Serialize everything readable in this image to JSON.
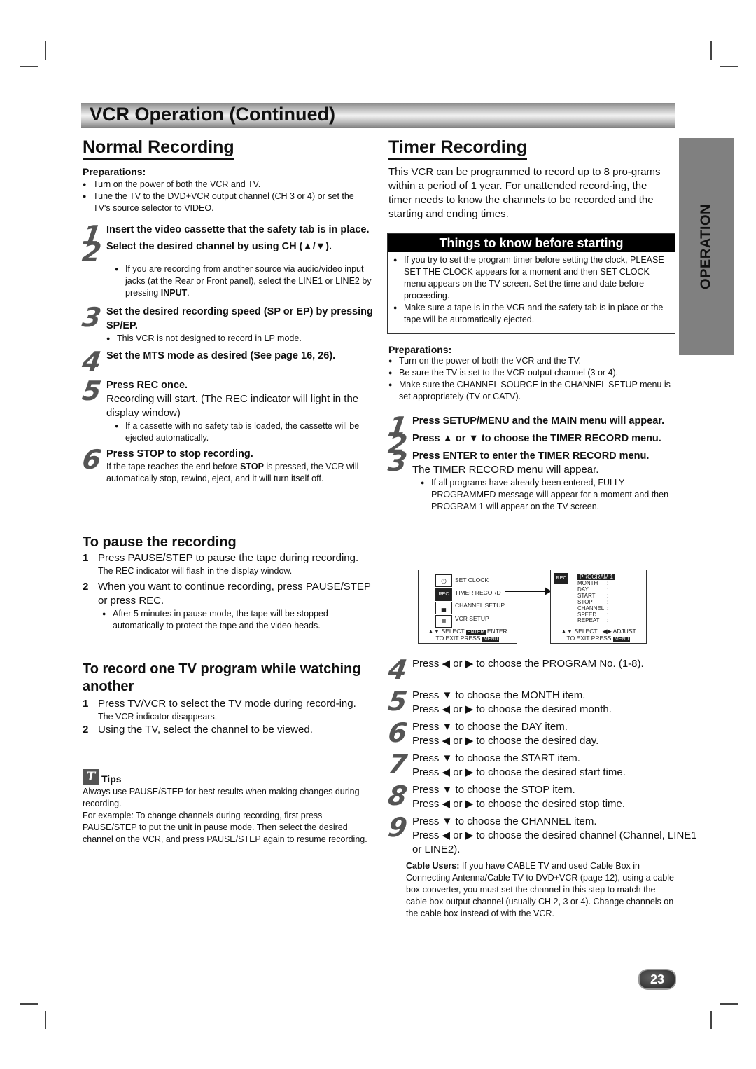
{
  "header": {
    "title": "VCR Operation (Continued)"
  },
  "side_tab": {
    "label": "OPERATION"
  },
  "page_number": "23",
  "normal_recording": {
    "title": "Normal Recording",
    "preparations_title": "Preparations:",
    "preparations": [
      "Turn on the power of both the VCR and TV.",
      "Tune the TV to the DVD+VCR output channel (CH 3 or 4) or set the TV's source selector to VIDEO."
    ],
    "steps": [
      {
        "num": "1",
        "title": "Insert the video cassette that the safety tab is in place."
      },
      {
        "num": "2",
        "title": "Select the desired channel by using CH (▲/▼).",
        "note_pre": "If you are recording from another source via audio/video input jacks (at the Rear or Front panel), select the LINE1 or LINE2 by pressing ",
        "note_bold": "INPUT",
        "note_post": "."
      },
      {
        "num": "3",
        "title": "Set the desired recording speed (SP or EP) by pressing SP/EP.",
        "note": "This VCR is not designed to record in LP mode."
      },
      {
        "num": "4",
        "title": "Set the MTS mode as desired (See page 16, 26)."
      },
      {
        "num": "5",
        "title": "Press REC once.",
        "body": "Recording will start. (The REC indicator will light in the display window)",
        "note": "If a cassette with no safety tab is loaded, the cassette will be ejected automatically."
      },
      {
        "num": "6",
        "title": "Press STOP to stop recording.",
        "body_pre": "If the tape reaches the end before ",
        "body_bold": "STOP",
        "body_post": " is pressed, the VCR will automatically stop, rewind, eject, and it will turn itself off."
      }
    ]
  },
  "pause": {
    "title": "To pause the recording",
    "items": [
      {
        "n": "1",
        "text": "Press PAUSE/STEP to pause the tape during recording.",
        "sub": "The REC indicator will flash in the display window."
      },
      {
        "n": "2",
        "text": "When you want to continue recording, press PAUSE/STEP or press REC.",
        "note": "After 5 minutes in pause mode, the tape will be stopped automatically to protect the tape and the video heads."
      }
    ]
  },
  "watch_other": {
    "title": "To record one TV program while watching another",
    "items": [
      {
        "n": "1",
        "text": "Press TV/VCR to select the TV mode during record-ing.",
        "sub": "The VCR indicator disappears."
      },
      {
        "n": "2",
        "text": "Using the TV, select the channel to be viewed."
      }
    ]
  },
  "tips": {
    "title": "Tips",
    "p1": "Always use PAUSE/STEP for best results when making changes during recording.",
    "p2": "For example: To change channels during recording, first press PAUSE/STEP to put the unit in pause mode. Then select the desired channel on the VCR, and press PAUSE/STEP again to resume recording."
  },
  "timer_recording": {
    "title": "Timer Recording",
    "intro": "This VCR can be programmed to record up to 8 pro-grams within a period of 1 year. For unattended record-ing, the timer needs to know the channels to be recorded and the starting and ending times.",
    "things_box": {
      "title": "Things to know before starting",
      "items": [
        "If you try to set the program timer before setting the clock, PLEASE SET THE CLOCK appears for a moment and then SET CLOCK menu appears on the TV screen. Set the time and date before proceeding.",
        "Make sure a tape is in the VCR and the safety tab is in place or the tape will be automatically ejected."
      ]
    },
    "preparations_title": "Preparations:",
    "preparations": [
      "Turn on the power of both the VCR and the TV.",
      "Be sure the TV is set to the VCR output channel (3 or 4).",
      "Make sure the CHANNEL SOURCE in the CHANNEL SETUP menu is set appropriately (TV or CATV)."
    ],
    "steps_bold": [
      {
        "num": "1",
        "title": "Press SETUP/MENU and the MAIN menu will appear."
      },
      {
        "num": "2",
        "title": "Press ▲ or ▼ to choose the TIMER RECORD menu."
      },
      {
        "num": "3",
        "title": "Press ENTER to enter the TIMER RECORD menu.",
        "body": "The TIMER RECORD menu will appear.",
        "note": "If all programs have already been entered, FULLY PROGRAMMED message will appear for a moment and then PROGRAM 1 will appear on the TV screen."
      }
    ],
    "main_menu": {
      "items": [
        {
          "icon": "clock-icon",
          "label": "SET  CLOCK"
        },
        {
          "icon": "rec-icon",
          "label": "TIMER RECORD"
        },
        {
          "icon": "antenna-icon",
          "label": "CHANNEL  SETUP"
        },
        {
          "icon": "vcr-setup-icon",
          "label": "VCR SETUP"
        }
      ],
      "footer1_a": "▲▼ SELECT",
      "footer1_key": "ENTER",
      "footer1_b": "ENTER",
      "footer2": "TO  EXIT   PRESS",
      "footer2_key": "MENU"
    },
    "timer_menu": {
      "header": "PROGRAM  1",
      "fields": [
        "MONTH",
        "DAY",
        "START",
        "STOP",
        "CHANNEL",
        "SPEED",
        "REPEAT"
      ],
      "footer1_a": "▲▼ SELECT",
      "footer1_b": "◀▶ ADJUST",
      "footer2": "TO  EXIT   PRESS",
      "footer2_key": "MENU"
    },
    "steps_plain": [
      {
        "num": "4",
        "lines": [
          "Press ◀ or ▶ to choose the PROGRAM No. (1-8)."
        ]
      },
      {
        "num": "5",
        "lines": [
          "Press ▼ to choose the MONTH item.",
          "Press ◀ or ▶ to choose the desired month."
        ]
      },
      {
        "num": "6",
        "lines": [
          "Press ▼ to choose the DAY item.",
          "Press ◀ or ▶ to choose the desired day."
        ]
      },
      {
        "num": "7",
        "lines": [
          "Press ▼ to choose the START item.",
          "Press ◀ or ▶ to choose the desired start time."
        ]
      },
      {
        "num": "8",
        "lines": [
          "Press ▼ to choose the STOP item.",
          "Press ◀ or ▶ to choose the desired stop time."
        ]
      },
      {
        "num": "9",
        "lines": [
          "Press ▼ to choose the CHANNEL item.",
          "Press ◀ or ▶ to choose the desired channel (Channel, LINE1 or LINE2)."
        ]
      }
    ],
    "cable_label": "Cable Users:",
    "cable_text": " If you have CABLE TV and used Cable Box in Connecting Antenna/Cable TV to DVD+VCR (page 12), using a cable box converter, you must set the channel in this step to match the cable box output channel (usually CH 2, 3 or 4). Change channels on the cable box instead of with the VCR."
  }
}
